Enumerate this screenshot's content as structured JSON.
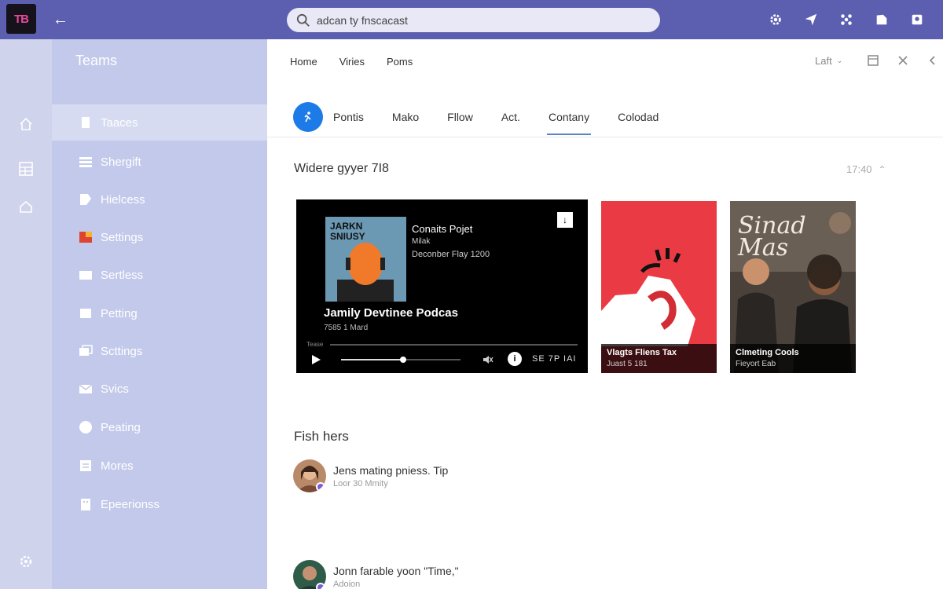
{
  "app": {
    "logo_text": "TB",
    "back_label": "←"
  },
  "search": {
    "value": "adcan ty fnscacast",
    "placeholder": "adcan ty fnscacast"
  },
  "topbar_icons": [
    "settings-icon",
    "send-icon",
    "apps-icon",
    "bookmark-icon",
    "account-icon"
  ],
  "rail": {
    "icons": [
      "home-icon",
      "grid-icon",
      "house-icon",
      "settings-icon"
    ]
  },
  "sidebar": {
    "title": "Teams",
    "items": [
      {
        "label": "Taaces",
        "icon": "page-icon",
        "active": true
      },
      {
        "label": "Shergift",
        "icon": "list-icon",
        "active": false
      },
      {
        "label": "Hielcess",
        "icon": "tag-icon",
        "active": false
      },
      {
        "label": "Settings",
        "icon": "flag-icon",
        "active": false
      },
      {
        "label": "Sertless",
        "icon": "card-icon",
        "active": false
      },
      {
        "label": "Petting",
        "icon": "doc-icon",
        "active": false
      },
      {
        "label": "Scttings",
        "icon": "stack-icon",
        "active": false
      },
      {
        "label": "Svics",
        "icon": "mail-icon",
        "active": false
      },
      {
        "label": "Peating",
        "icon": "circle-icon",
        "active": false
      },
      {
        "label": "Mores",
        "icon": "notes-icon",
        "active": false
      },
      {
        "label": "Epeerionss",
        "icon": "building-icon",
        "active": false
      }
    ]
  },
  "main": {
    "nav_links": [
      "Home",
      "Viries",
      "Poms"
    ],
    "view_select": "Laft",
    "tabs": [
      {
        "label": "Pontis",
        "active": false
      },
      {
        "label": "Mako",
        "active": false
      },
      {
        "label": "Fllow",
        "active": false
      },
      {
        "label": "Act.",
        "active": false
      },
      {
        "label": "Contany",
        "active": true
      },
      {
        "label": "Colodad",
        "active": false
      }
    ],
    "section_title": "Widere gyyer 7I8",
    "section_time": "17:40",
    "player": {
      "art_text": "JARKN\nSNIUSY",
      "title": "Conaits Pojet",
      "subtitle": "Milak",
      "date": "Deconber Flay 1200",
      "download": "↓",
      "show": "Jamily Devtinee Podcas",
      "meta": "7585 1 Mard",
      "label": "Tease",
      "progress": 0.52,
      "info": "i",
      "speed": "SE 7P IAI"
    },
    "cards": [
      {
        "title": "Vlagts Fliens Tax",
        "subtitle": "Juast 5 181",
        "color": "#ea3b44"
      },
      {
        "title": "Clmeting Cools",
        "subtitle": "Fieyort Eab",
        "overlay_text": "Sinad Mas"
      }
    ],
    "section2_title": "Fish hers",
    "feed": [
      {
        "title": "Jens mating pniess. Tip",
        "subtitle": "Loor 30 Mmity"
      },
      {
        "title": "Jonn farable yoon \"Time,\"",
        "subtitle": "Adoion"
      }
    ]
  },
  "colors": {
    "topbar": "#5c5fb0",
    "sidebar": "#c3c9ea",
    "accent": "#1d7be8"
  }
}
